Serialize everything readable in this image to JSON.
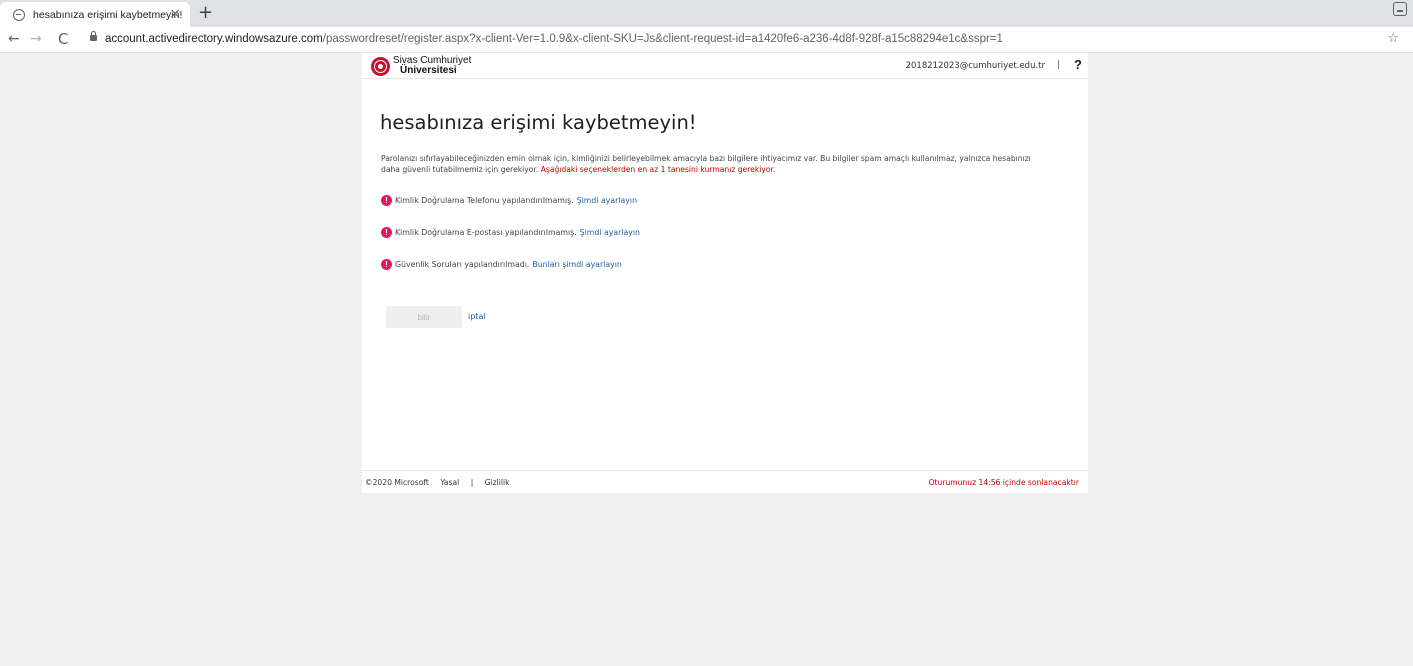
{
  "browser": {
    "tab_title": "hesabınıza erişimi kaybetmeyin!",
    "tab_close": "×",
    "new_tab": "+",
    "url_host": "account.activedirectory.windowsazure.com",
    "url_path": "/passwordreset/register.aspx?x-client-Ver=1.0.9&x-client-SKU=Js&client-request-id=a1420fe6-a236-4d8f-928f-a15c88294e1c&sspr=1",
    "back": "←",
    "forward": "→",
    "reload": "C",
    "star": "☆"
  },
  "header": {
    "brand_line1": "Sivas Cumhuriyet",
    "brand_line2": "Üniversitesi",
    "user": "2018212023@cumhuriyet.edu.tr",
    "separator": "|",
    "help": "?"
  },
  "main": {
    "title": "hesabınıza erişimi kaybetmeyin!",
    "description": "Parolanızı sıfırlayabileceğinizden emin olmak için, kimliğinizi belirleyebilmek amacıyla bazı bilgilere ihtiyacımız var. Bu bilgiler spam amaçlı kullanılmaz, yalnızca hesabınızı daha güvenli tutabilmemiz için gerekiyor.",
    "warning": "Aşağıdaki seçeneklerden en az 1 tanesini kurmanız gerekiyor.",
    "items": [
      {
        "text": "Kimlik Doğrulama Telefonu yapılandırılmamış.",
        "link": "Şimdi ayarlayın"
      },
      {
        "text": "Kimlik Doğrulama E-postası yapılandırılmamış.",
        "link": "Şimdi ayarlayın"
      },
      {
        "text": "Güvenlik Soruları yapılandırılmadı.",
        "link": "Bunları şimdi ayarlayın"
      }
    ],
    "alert_glyph": "!",
    "finish_label": "bitir",
    "cancel_label": "iptal"
  },
  "footer": {
    "copyright": "©2020 Microsoft",
    "legal": "Yasal",
    "separator": "|",
    "privacy": "Gizlilik",
    "session": "Oturumunuz 14:56 içinde sonlanacaktır"
  },
  "colors": {
    "alert": "#e3185d",
    "warning_text": "#c00000",
    "link": "#1f5fa8",
    "brand": "#c8102e"
  }
}
